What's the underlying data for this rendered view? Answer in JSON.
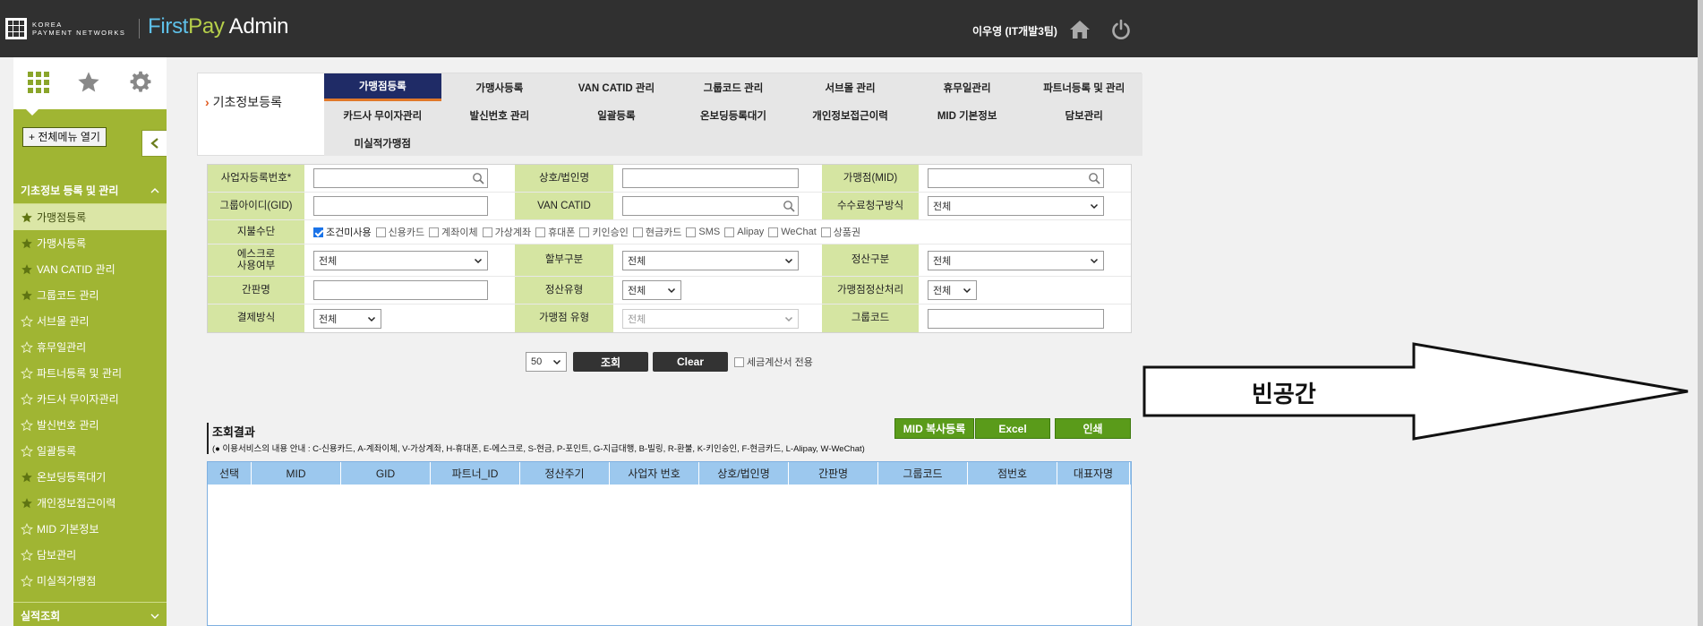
{
  "header": {
    "company_line1": "KOREA",
    "company_line2": "PAYMENT NETWORKS",
    "brand_first": "First",
    "brand_pay": "Pay",
    "brand_admin": "Admin",
    "user_name": "이우영 (IT개발3팀)"
  },
  "sidebar": {
    "open_all_label": "+ 전체메뉴 열기",
    "section_title": "기초정보 등록 및 관리",
    "items": [
      {
        "label": "가맹점등록",
        "active": true,
        "star": "filled"
      },
      {
        "label": "가맹사등록",
        "star": "filled"
      },
      {
        "label": "VAN CATID 관리",
        "star": "filled"
      },
      {
        "label": "그룹코드 관리",
        "star": "filled"
      },
      {
        "label": "서브몰 관리",
        "star": "outline"
      },
      {
        "label": "휴무일관리",
        "star": "outline"
      },
      {
        "label": "파트너등록 및 관리",
        "star": "outline"
      },
      {
        "label": "카드사 무이자관리",
        "star": "outline"
      },
      {
        "label": "발신번호 관리",
        "star": "outline"
      },
      {
        "label": "일괄등록",
        "star": "outline"
      },
      {
        "label": "온보딩등록대기",
        "star": "filled"
      },
      {
        "label": "개인정보접근이력",
        "star": "filled"
      },
      {
        "label": "MID 기본정보",
        "star": "outline"
      },
      {
        "label": "담보관리",
        "star": "outline"
      },
      {
        "label": "미실적가맹점",
        "star": "outline"
      }
    ],
    "section2_title": "실적조회"
  },
  "breadcrumb": "기초정보등록",
  "tabs": [
    "가맹점등록",
    "가맹사등록",
    "VAN CATID 관리",
    "그룹코드 관리",
    "서브몰 관리",
    "휴무일관리",
    "파트너등록 및 관리",
    "카드사 무이자관리",
    "발신번호 관리",
    "일괄등록",
    "온보딩등록대기",
    "개인정보접근이력",
    "MID 기본정보",
    "담보관리",
    "미실적가맹점"
  ],
  "form": {
    "biz_no_label": "사업자등록번호*",
    "company_label": "상호/법인명",
    "mid_label": "가맹점(MID)",
    "gid_label": "그룹아이디(GID)",
    "catid_label": "VAN CATID",
    "fee_method_label": "수수료청구방식",
    "fee_method_value": "전체",
    "pay_method_label": "지불수단",
    "pay_methods": [
      {
        "label": "조건미사용",
        "checked": true
      },
      {
        "label": "신용카드",
        "checked": false
      },
      {
        "label": "계좌이체",
        "checked": false
      },
      {
        "label": "가상계좌",
        "checked": false
      },
      {
        "label": "휴대폰",
        "checked": false
      },
      {
        "label": "키인승인",
        "checked": false
      },
      {
        "label": "현금카드",
        "checked": false
      },
      {
        "label": "SMS",
        "checked": false
      },
      {
        "label": "Alipay",
        "checked": false
      },
      {
        "label": "WeChat",
        "checked": false
      },
      {
        "label": "상품권",
        "checked": false
      }
    ],
    "escrow_label_1": "에스크로",
    "escrow_label_2": "사용여부",
    "escrow_value": "전체",
    "installment_label": "할부구분",
    "installment_value": "전체",
    "settle_div_label": "정산구분",
    "settle_div_value": "전체",
    "signboard_label": "간판명",
    "settle_type_label": "정산유형",
    "settle_type_value": "전체",
    "merchant_settle_label": "가맹점정산처리",
    "merchant_settle_value": "전체",
    "payment_type_label": "결제방식",
    "payment_type_value": "전체",
    "merchant_type_label": "가맹점 유형",
    "merchant_type_value": "전체",
    "group_code_label": "그룹코드"
  },
  "actions": {
    "page_size": "50",
    "search_label": "조회",
    "clear_label": "Clear",
    "tax_invoice_label": "세금계산서 전용"
  },
  "results": {
    "title": "조회결과",
    "desc": "(● 이용서비스의 내용 안내 : C-신용카드, A-계좌이체, V-가상계좌, H-휴대폰, E-에스크로, S-현금, P-포인트, G-지급대행, B-빌링, R-환불, K-키인승인, F-현금카드, L-Alipay, W-WeChat)",
    "mid_copy_label": "MID 복사등록",
    "excel_label": "Excel",
    "print_label": "인쇄",
    "columns": [
      "선택",
      "MID",
      "GID",
      "파트너_ID",
      "정산주기",
      "사업자 번호",
      "상호/법인명",
      "간판명",
      "그룹코드",
      "점번호",
      "대표자명"
    ]
  },
  "annotation": {
    "label": "빈공간"
  },
  "colors": {
    "topbar": "#303030",
    "sidebar": "#a0b533",
    "active_tab": "#1f2b66",
    "form_label": "#d5e5a2",
    "grid_header": "#9cc8ee",
    "green_button": "#5a9b1a"
  }
}
